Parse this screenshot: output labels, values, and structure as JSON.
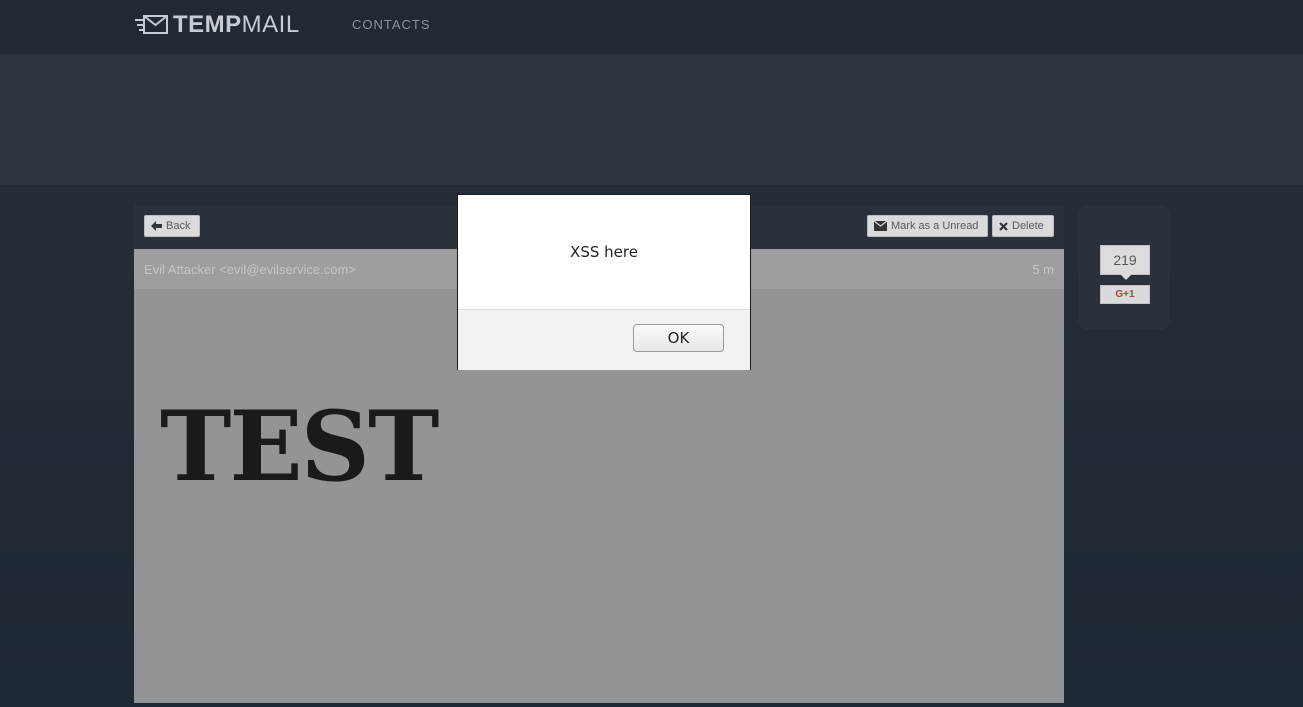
{
  "header": {
    "logo_bold": "TEMP",
    "logo_light": "MAIL",
    "nav_contacts": "CONTACTS",
    "logo_icon": "envelope-speed-icon"
  },
  "toolbar": {
    "back_label": "Back",
    "mark_unread_label": "Mark as a Unread",
    "delete_label": "Delete"
  },
  "message": {
    "from": "Evil Attacker <evil@evilservice.com>",
    "time": "5 m",
    "body_text": "TEST"
  },
  "social": {
    "count": "219",
    "gplus_label": "G+1"
  },
  "dialog": {
    "message": "XSS here",
    "ok_label": "OK"
  },
  "colors": {
    "background": "#1b2530",
    "topbar": "#222932",
    "panel_gray": "#929496",
    "gplus_red": "#c33c2e"
  }
}
